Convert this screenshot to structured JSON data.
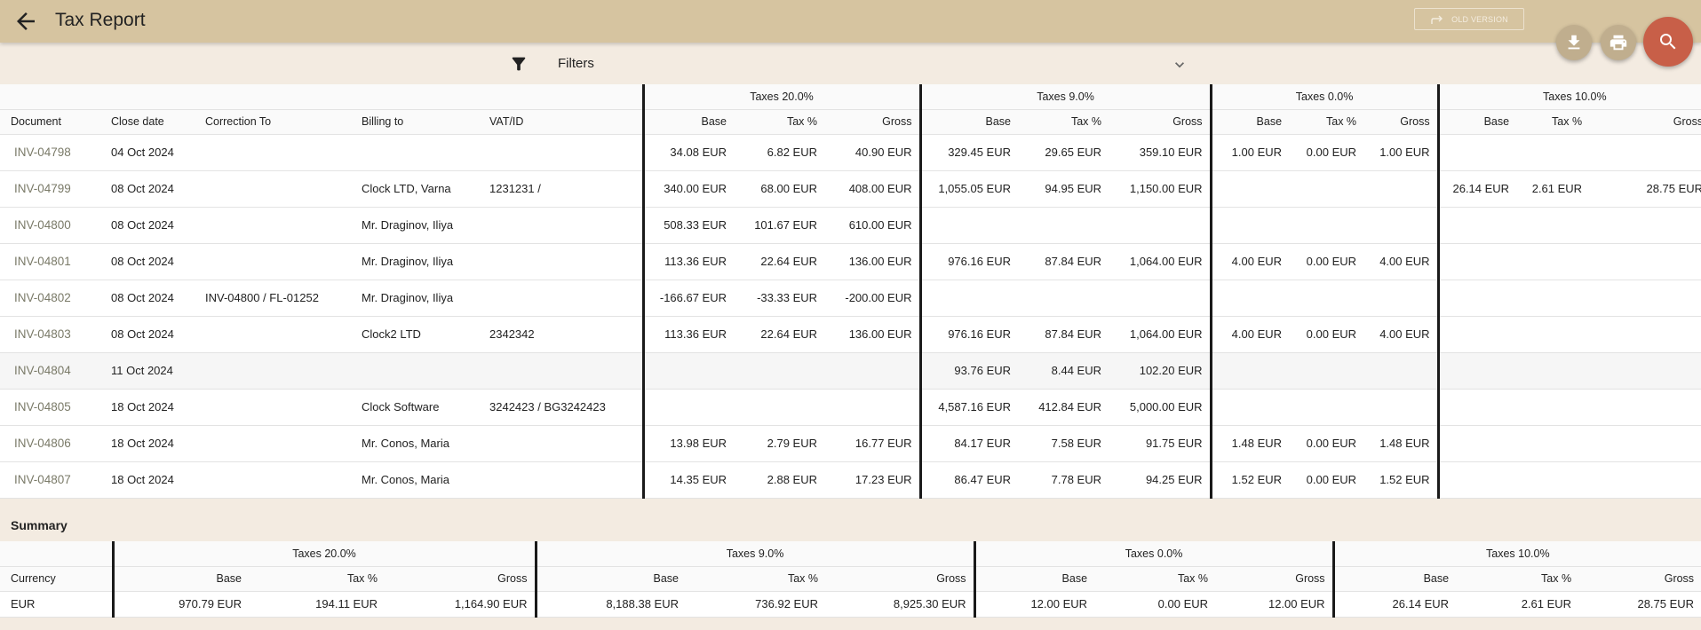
{
  "app": {
    "title": "Tax Report",
    "old_version_label": "OLD VERSION"
  },
  "filters": {
    "label": "Filters"
  },
  "icons": {
    "back": "arrow-left-icon",
    "download": "download-icon",
    "print": "printer-icon",
    "search": "search-icon",
    "filter": "filter-icon",
    "expand": "chevron-down-icon",
    "redo": "redo-arrow-icon"
  },
  "colors": {
    "header": "#d6c4a0",
    "background": "#f3ebe1",
    "search_fab": "#c85f48",
    "small_fab": "#c0ae8e",
    "link": "#7a7a68"
  },
  "groups": [
    "Taxes 20.0%",
    "Taxes 9.0%",
    "Taxes 0.0%",
    "Taxes 10.0%"
  ],
  "columns": [
    "Document",
    "Close date",
    "Correction To",
    "Billing to",
    "VAT/ID"
  ],
  "sub_columns": [
    "Base",
    "Tax %",
    "Gross"
  ],
  "rows": [
    {
      "doc": "INV-04798",
      "date": "04 Oct 2024",
      "correction": "",
      "billing": "",
      "vat": "",
      "t20": [
        "34.08 EUR",
        "6.82 EUR",
        "40.90 EUR"
      ],
      "t9": [
        "329.45 EUR",
        "29.65 EUR",
        "359.10 EUR"
      ],
      "t0": [
        "1.00 EUR",
        "0.00 EUR",
        "1.00 EUR"
      ],
      "t10": [
        "",
        "",
        ""
      ]
    },
    {
      "doc": "INV-04799",
      "date": "08 Oct 2024",
      "correction": "",
      "billing": "Clock LTD, Varna",
      "vat": "1231231 /",
      "t20": [
        "340.00 EUR",
        "68.00 EUR",
        "408.00 EUR"
      ],
      "t9": [
        "1,055.05 EUR",
        "94.95 EUR",
        "1,150.00 EUR"
      ],
      "t0": [
        "",
        "",
        ""
      ],
      "t10": [
        "26.14 EUR",
        "2.61 EUR",
        "28.75 EUR"
      ]
    },
    {
      "doc": "INV-04800",
      "date": "08 Oct 2024",
      "correction": "",
      "billing": "Mr. Draginov, Iliya",
      "vat": "",
      "t20": [
        "508.33 EUR",
        "101.67 EUR",
        "610.00 EUR"
      ],
      "t9": [
        "",
        "",
        ""
      ],
      "t0": [
        "",
        "",
        ""
      ],
      "t10": [
        "",
        "",
        ""
      ]
    },
    {
      "doc": "INV-04801",
      "date": "08 Oct 2024",
      "correction": "",
      "billing": "Mr. Draginov, Iliya",
      "vat": "",
      "t20": [
        "113.36 EUR",
        "22.64 EUR",
        "136.00 EUR"
      ],
      "t9": [
        "976.16 EUR",
        "87.84 EUR",
        "1,064.00 EUR"
      ],
      "t0": [
        "4.00 EUR",
        "0.00 EUR",
        "4.00 EUR"
      ],
      "t10": [
        "",
        "",
        ""
      ]
    },
    {
      "doc": "INV-04802",
      "date": "08 Oct 2024",
      "correction": "INV-04800 / FL-01252",
      "billing": "Mr. Draginov, Iliya",
      "vat": "",
      "t20": [
        "-166.67 EUR",
        "-33.33 EUR",
        "-200.00 EUR"
      ],
      "t9": [
        "",
        "",
        ""
      ],
      "t0": [
        "",
        "",
        ""
      ],
      "t10": [
        "",
        "",
        ""
      ]
    },
    {
      "doc": "INV-04803",
      "date": "08 Oct 2024",
      "correction": "",
      "billing": "Clock2 LTD",
      "vat": "2342342",
      "t20": [
        "113.36 EUR",
        "22.64 EUR",
        "136.00 EUR"
      ],
      "t9": [
        "976.16 EUR",
        "87.84 EUR",
        "1,064.00 EUR"
      ],
      "t0": [
        "4.00 EUR",
        "0.00 EUR",
        "4.00 EUR"
      ],
      "t10": [
        "",
        "",
        ""
      ]
    },
    {
      "doc": "INV-04804",
      "date": "11 Oct 2024",
      "correction": "",
      "billing": "",
      "vat": "",
      "t20": [
        "",
        "",
        ""
      ],
      "t9": [
        "93.76 EUR",
        "8.44 EUR",
        "102.20 EUR"
      ],
      "t0": [
        "",
        "",
        ""
      ],
      "t10": [
        "",
        "",
        ""
      ]
    },
    {
      "doc": "INV-04805",
      "date": "18 Oct 2024",
      "correction": "",
      "billing": "Clock Software",
      "vat": "3242423 / BG3242423",
      "t20": [
        "",
        "",
        ""
      ],
      "t9": [
        "4,587.16 EUR",
        "412.84 EUR",
        "5,000.00 EUR"
      ],
      "t0": [
        "",
        "",
        ""
      ],
      "t10": [
        "",
        "",
        ""
      ]
    },
    {
      "doc": "INV-04806",
      "date": "18 Oct 2024",
      "correction": "",
      "billing": "Mr. Conos, Maria",
      "vat": "",
      "t20": [
        "13.98 EUR",
        "2.79 EUR",
        "16.77 EUR"
      ],
      "t9": [
        "84.17 EUR",
        "7.58 EUR",
        "91.75 EUR"
      ],
      "t0": [
        "1.48 EUR",
        "0.00 EUR",
        "1.48 EUR"
      ],
      "t10": [
        "",
        "",
        ""
      ]
    },
    {
      "doc": "INV-04807",
      "date": "18 Oct 2024",
      "correction": "",
      "billing": "Mr. Conos, Maria",
      "vat": "",
      "t20": [
        "14.35 EUR",
        "2.88 EUR",
        "17.23 EUR"
      ],
      "t9": [
        "86.47 EUR",
        "7.78 EUR",
        "94.25 EUR"
      ],
      "t0": [
        "1.52 EUR",
        "0.00 EUR",
        "1.52 EUR"
      ],
      "t10": [
        "",
        "",
        ""
      ]
    }
  ],
  "summary": {
    "title": "Summary",
    "currency_label": "Currency",
    "rows": [
      {
        "currency": "EUR",
        "t20": [
          "970.79 EUR",
          "194.11 EUR",
          "1,164.90 EUR"
        ],
        "t9": [
          "8,188.38 EUR",
          "736.92 EUR",
          "8,925.30 EUR"
        ],
        "t0": [
          "12.00 EUR",
          "0.00 EUR",
          "12.00 EUR"
        ],
        "t10": [
          "26.14 EUR",
          "2.61 EUR",
          "28.75 EUR"
        ]
      }
    ]
  }
}
